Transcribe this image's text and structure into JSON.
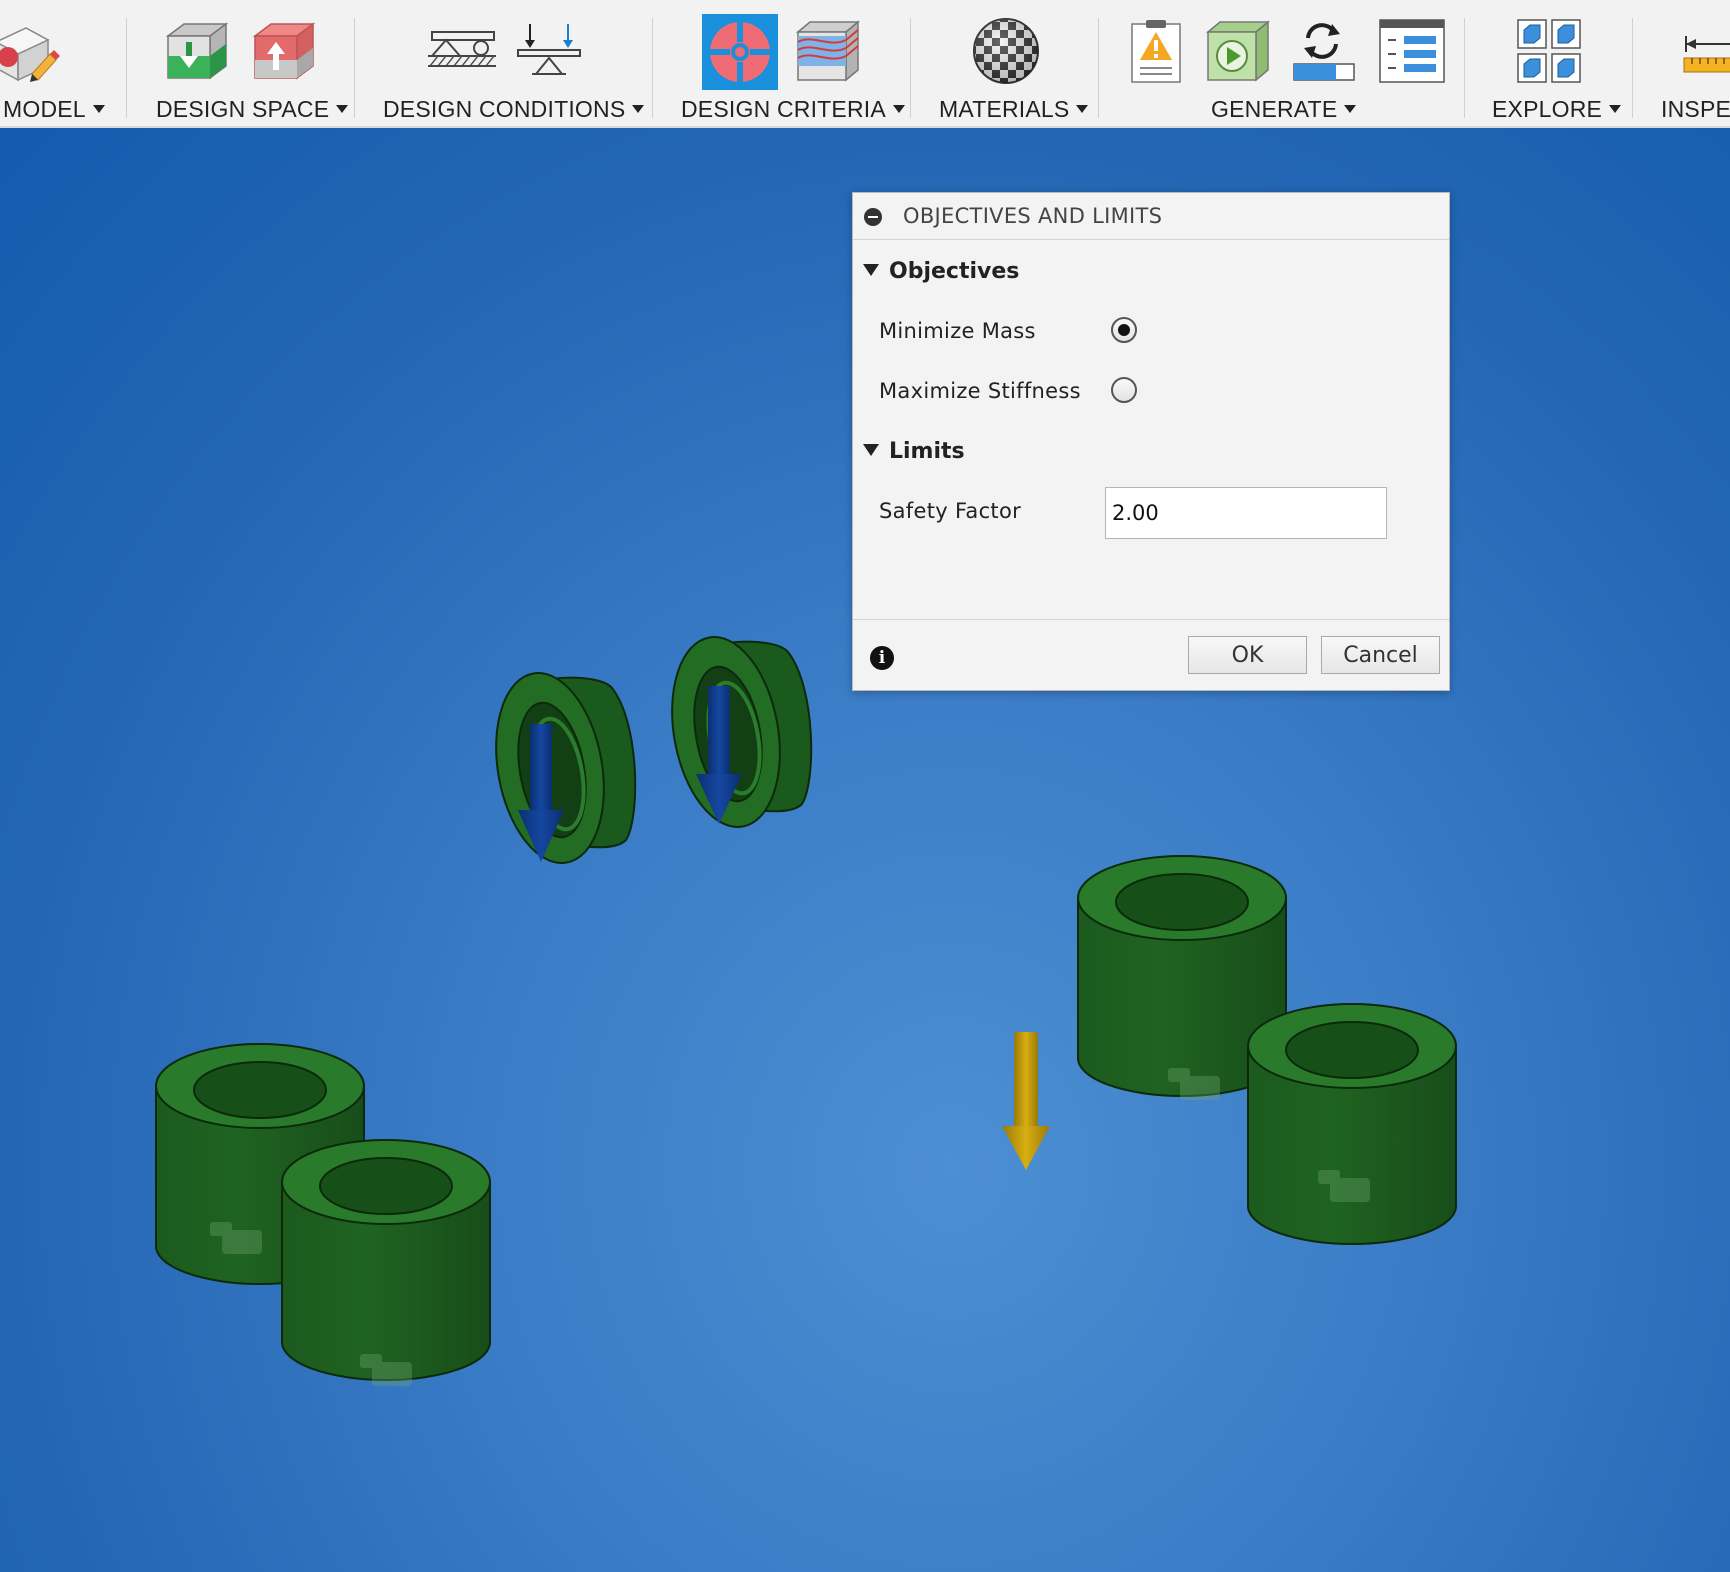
{
  "toolbar": {
    "groups": [
      {
        "label": "MODEL"
      },
      {
        "label": "DESIGN SPACE"
      },
      {
        "label": "DESIGN CONDITIONS"
      },
      {
        "label": "DESIGN CRITERIA"
      },
      {
        "label": "MATERIALS"
      },
      {
        "label": "GENERATE"
      },
      {
        "label": "EXPLORE"
      },
      {
        "label": "INSPEC"
      }
    ],
    "active_color": "#1a8fdc"
  },
  "dialog": {
    "title": "OBJECTIVES AND LIMITS",
    "objectives": {
      "heading": "Objectives",
      "options": [
        {
          "label": "Minimize Mass",
          "selected": true
        },
        {
          "label": "Maximize Stiffness",
          "selected": false
        }
      ]
    },
    "limits": {
      "heading": "Limits",
      "safety_factor_label": "Safety Factor",
      "safety_factor_value": "2.00"
    },
    "ok_label": "OK",
    "cancel_label": "Cancel"
  },
  "scene": {
    "background_color": "#2c72bf",
    "obstacle_color": "#1f6321",
    "load_arrow_color": "#0d3f8e",
    "gravity_arrow_color": "#c9a20a"
  }
}
